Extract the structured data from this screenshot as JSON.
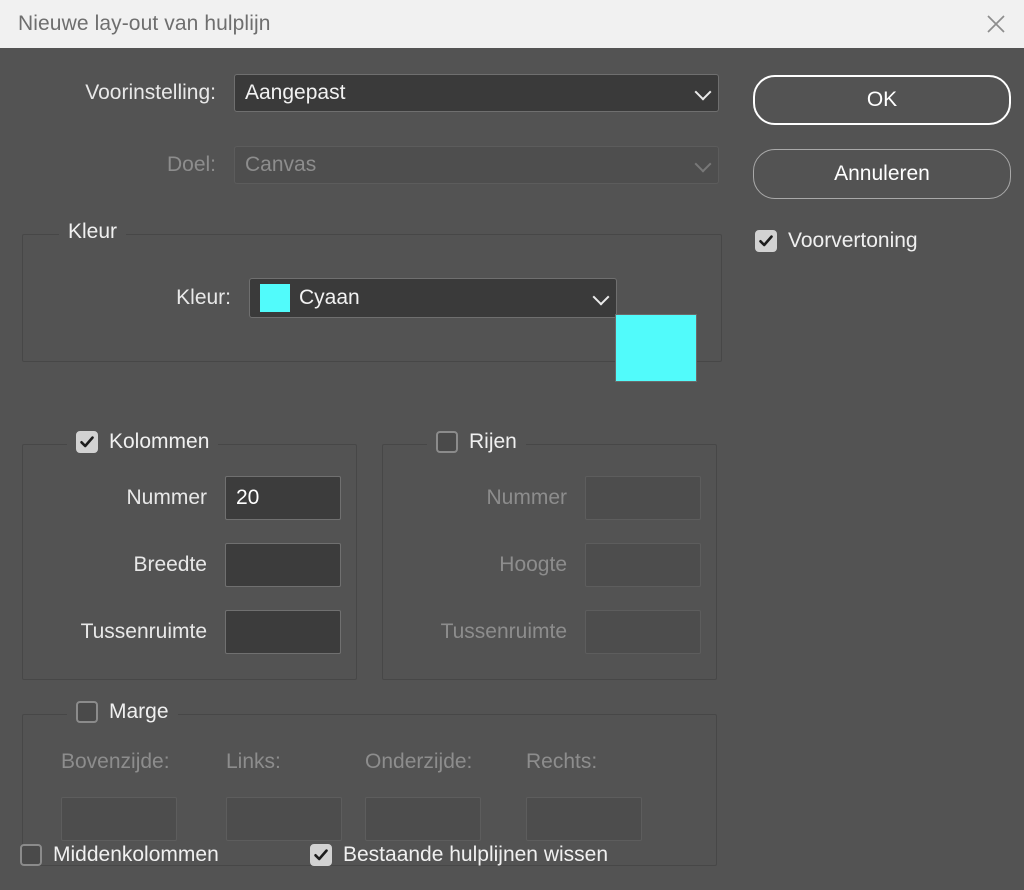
{
  "window": {
    "title": "Nieuwe lay-out van hulplijn",
    "close_icon": "close-icon"
  },
  "form": {
    "preset": {
      "label": "Voorinstelling:",
      "value": "Aangepast",
      "enabled": true
    },
    "target": {
      "label": "Doel:",
      "value": "Canvas",
      "enabled": false
    }
  },
  "buttons": {
    "ok": "OK",
    "cancel": "Annuleren"
  },
  "preview_checkbox": {
    "label": "Voorvertoning",
    "checked": true
  },
  "color_group": {
    "legend": "Kleur",
    "field_label": "Kleur:",
    "value": "Cyaan",
    "swatch_color": "#51FBFB",
    "preview_color": "#51FBFB"
  },
  "columns_group": {
    "legend": "Kolommen",
    "checked": true,
    "rows": [
      {
        "label": "Nummer",
        "value": "20"
      },
      {
        "label": "Breedte",
        "value": ""
      },
      {
        "label": "Tussenruimte",
        "value": ""
      }
    ]
  },
  "rows_group": {
    "legend": "Rijen",
    "checked": false,
    "rows": [
      {
        "label": "Nummer",
        "value": ""
      },
      {
        "label": "Hoogte",
        "value": ""
      },
      {
        "label": "Tussenruimte",
        "value": ""
      }
    ]
  },
  "margin_group": {
    "legend": "Marge",
    "checked": false,
    "fields": [
      {
        "label": "Bovenzijde:",
        "value": ""
      },
      {
        "label": "Links:",
        "value": ""
      },
      {
        "label": "Onderzijde:",
        "value": ""
      },
      {
        "label": "Rechts:",
        "value": ""
      }
    ]
  },
  "footer": {
    "center_columns": {
      "label": "Middenkolommen",
      "checked": false
    },
    "clear_guides": {
      "label": "Bestaande hulplijnen wissen",
      "checked": true
    }
  }
}
